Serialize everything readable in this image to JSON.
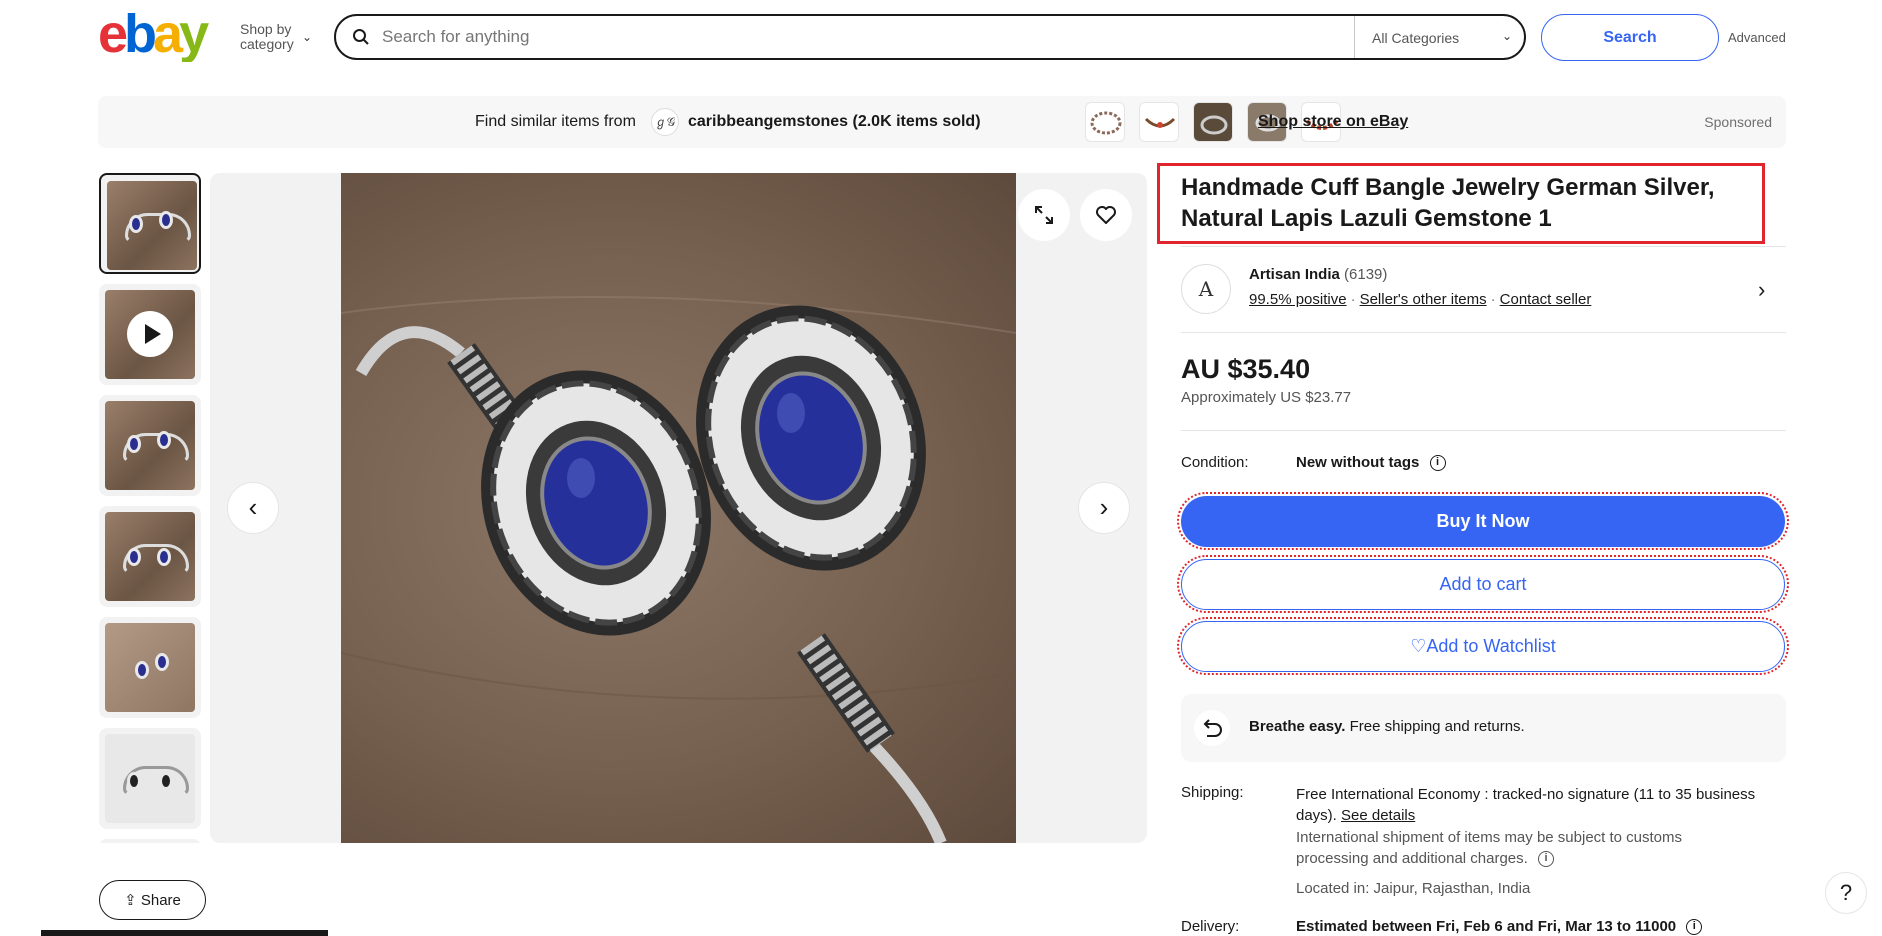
{
  "header": {
    "logo_text": "ebay",
    "shop_by_line1": "Shop by",
    "shop_by_line2": "category",
    "search_placeholder": "Search for anything",
    "category_selected": "All Categories",
    "search_button": "Search",
    "advanced_link": "Advanced"
  },
  "promo": {
    "find_text": "Find similar items from",
    "store_logo_text": "ℊ𝒢",
    "store_name": "caribbeangemstones  (2.0K items sold)",
    "shop_store_link": "Shop store on eBay",
    "sponsored": "Sponsored"
  },
  "gallery": {
    "share_label": "Share"
  },
  "listing": {
    "title": "Handmade Cuff Bangle Jewelry German Silver, Natural Lapis Lazuli Gemstone 1",
    "seller": {
      "avatar_text": "A",
      "name": "Artisan India",
      "feedback_count": "(6139)",
      "positive_link": "99.5% positive",
      "other_items_link": "Seller's other items",
      "contact_link": "Contact seller"
    },
    "price": "AU $35.40",
    "approx_price": "Approximately US $23.77",
    "condition_label": "Condition:",
    "condition_value": "New without tags",
    "buy_now": "Buy It Now",
    "add_to_cart": "Add to cart",
    "add_to_watchlist": "Add to Watchlist",
    "breathe_bold": "Breathe easy.",
    "breathe_text": " Free shipping and returns.",
    "shipping_label": "Shipping:",
    "shipping_value": "Free International Economy : tracked-no signature (11 to 35 business days). ",
    "see_details": "See details",
    "shipping_note": "International shipment of items may be subject to customs processing and additional charges.",
    "located": "Located in: Jaipur, Rajasthan, India",
    "delivery_label": "Delivery:",
    "delivery_value": "Estimated between Fri, Feb 6 and Fri, Mar 13 to 11000"
  },
  "help": "?",
  "colors": {
    "accent": "#3665f3",
    "highlight": "#e0262c",
    "ebay_red": "#e53238",
    "ebay_blue": "#0064d2",
    "ebay_yellow": "#f5af02",
    "ebay_green": "#86b817",
    "gem": "#2a2f8f"
  }
}
